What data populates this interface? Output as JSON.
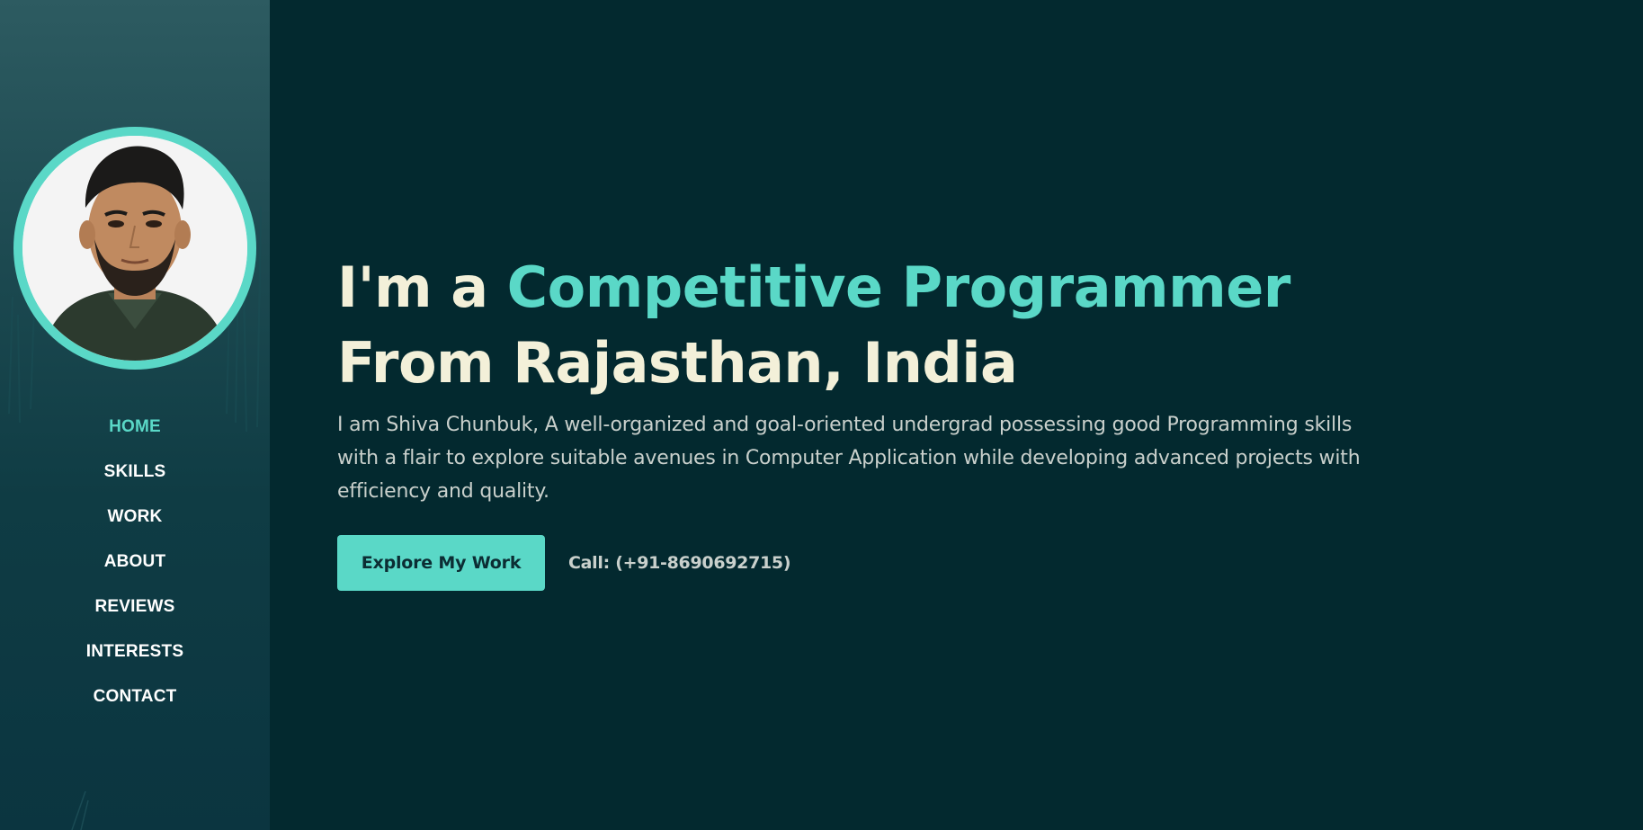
{
  "sidebar": {
    "avatar_alt": "profile-photo",
    "nav": [
      {
        "label": "HOME",
        "active": true
      },
      {
        "label": "SKILLS",
        "active": false
      },
      {
        "label": "WORK",
        "active": false
      },
      {
        "label": "ABOUT",
        "active": false
      },
      {
        "label": "REVIEWS",
        "active": false
      },
      {
        "label": "INTERESTS",
        "active": false
      },
      {
        "label": "CONTACT",
        "active": false
      }
    ]
  },
  "hero": {
    "heading_prefix": "I'm a ",
    "heading_accent": "Competitive Programmer",
    "heading_line2": "From Rajasthan, India",
    "description": "I am Shiva Chunbuk, A well-organized and goal-oriented undergrad possessing good Programming skills with a flair to explore suitable avenues in Computer Application while developing advanced projects with efficiency and quality.",
    "cta_label": "Explore My Work",
    "call_text": "Call: (+91-8690692715)"
  },
  "colors": {
    "background": "#03292f",
    "accent": "#5ad8c7",
    "heading": "#f3f0d9",
    "body_text": "#c9d0cc"
  }
}
